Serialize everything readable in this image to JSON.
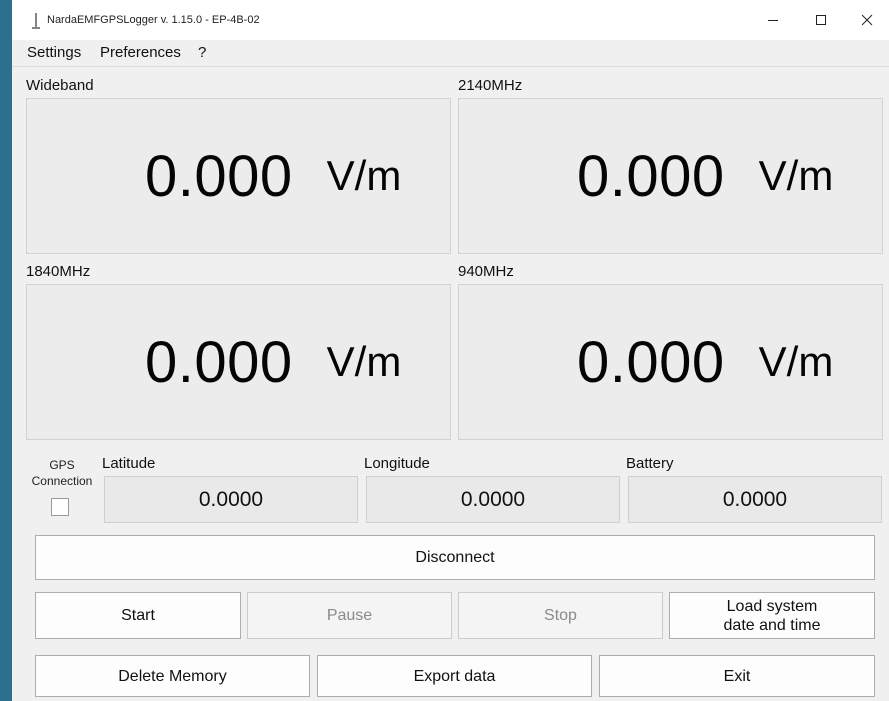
{
  "window": {
    "title": "NardaEMFGPSLogger v. 1.15.0 - EP-4B-02",
    "minimize_icon": "minimize-icon",
    "maximize_icon": "maximize-icon",
    "close_icon": "close-icon"
  },
  "menu": {
    "items": [
      "Settings",
      "Preferences",
      "?"
    ]
  },
  "meters": [
    {
      "label": "Wideband",
      "value": "0.000",
      "unit": "V/m"
    },
    {
      "label": "2140MHz",
      "value": "0.000",
      "unit": "V/m"
    },
    {
      "label": "1840MHz",
      "value": "0.000",
      "unit": "V/m"
    },
    {
      "label": "940MHz",
      "value": "0.000",
      "unit": "V/m"
    }
  ],
  "gps": {
    "connection_label_line1": "GPS",
    "connection_label_line2": "Connection",
    "connected": false,
    "latitude_label": "Latitude",
    "latitude_value": "0.0000",
    "longitude_label": "Longitude",
    "longitude_value": "0.0000",
    "battery_label": "Battery",
    "battery_value": "0.0000"
  },
  "buttons": {
    "disconnect": "Disconnect",
    "start": "Start",
    "pause": "Pause",
    "stop": "Stop",
    "load_time_line1": "Load system",
    "load_time_line2": "date and time",
    "delete_memory": "Delete Memory",
    "export_data": "Export data",
    "exit": "Exit"
  },
  "colors": {
    "accent_desktop": "#2c6f8f",
    "disabled_text": "#8a8a8a"
  }
}
